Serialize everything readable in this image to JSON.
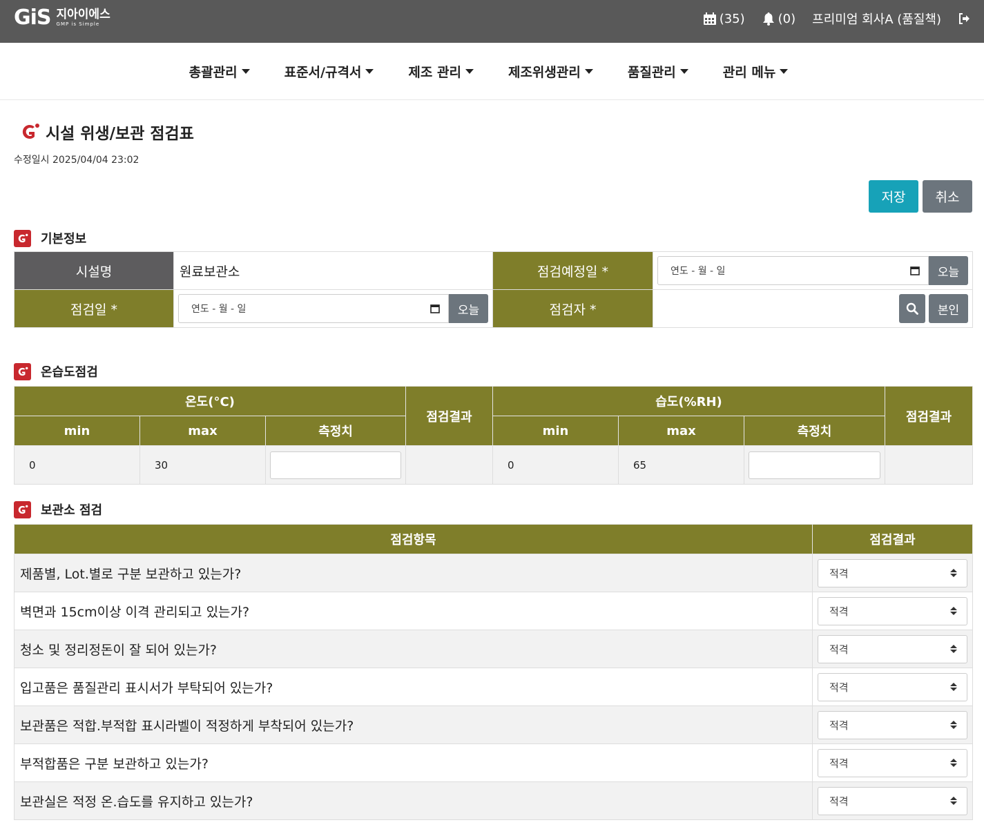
{
  "header": {
    "logo_mark": "GiS",
    "logo_name": "지아이에스",
    "logo_tagline": "GMP is Simple",
    "calendar_count": "(35)",
    "notification_count": "(0)",
    "user_label": "프리미엄 회사A (품질책)"
  },
  "nav": {
    "items": [
      {
        "label": "총괄관리"
      },
      {
        "label": "표준서/규격서"
      },
      {
        "label": "제조 관리"
      },
      {
        "label": "제조위생관리"
      },
      {
        "label": "품질관리"
      },
      {
        "label": "관리 메뉴"
      }
    ]
  },
  "page": {
    "title": "시설 위생/보관 점검표",
    "modified": "수정일시 2025/04/04 23:02",
    "save_label": "저장",
    "cancel_label": "취소"
  },
  "basic_info": {
    "section_title": "기본정보",
    "facility_label": "시설명",
    "facility_value": "원료보관소",
    "scheduled_date_label": "점검예정일 *",
    "scheduled_date_placeholder": "연도 - 월 - 일",
    "today_label": "오늘",
    "inspection_date_label": "점검일 *",
    "inspection_date_placeholder": "연도 - 월 - 일",
    "inspector_label": "점검자 *",
    "self_label": "본인"
  },
  "temp_humid": {
    "section_title": "온습도점검",
    "temp_header": "온도(°C)",
    "humid_header": "습도(%RH)",
    "result_header": "점검결과",
    "min_header": "min",
    "max_header": "max",
    "measure_header": "측정치",
    "temp_min": "0",
    "temp_max": "30",
    "humid_min": "0",
    "humid_max": "65"
  },
  "storage": {
    "section_title": "보관소 점검",
    "item_header": "점검항목",
    "result_header": "점검결과",
    "rows": [
      {
        "item": "제품별, Lot.별로 구분 보관하고 있는가?",
        "result": "적격"
      },
      {
        "item": "벽면과 15cm이상 이격 관리되고 있는가?",
        "result": "적격"
      },
      {
        "item": "청소 및 정리정돈이 잘 되어 있는가?",
        "result": "적격"
      },
      {
        "item": "입고품은 품질관리 표시서가 부탁되어 있는가?",
        "result": "적격"
      },
      {
        "item": "보관품은 적합.부적합 표시라벨이 적정하게 부착되어 있는가?",
        "result": "적격"
      },
      {
        "item": "부적합품은 구분 보관하고 있는가?",
        "result": "적격"
      },
      {
        "item": "보관실은 적정 온.습도를 유지하고 있는가?",
        "result": "적격"
      }
    ]
  },
  "colors": {
    "topbar": "#595959",
    "olive_header": "#7f7e2a",
    "save_button": "#17a2b8",
    "gray_button": "#6c757d",
    "brand_red": "#c8282e"
  }
}
